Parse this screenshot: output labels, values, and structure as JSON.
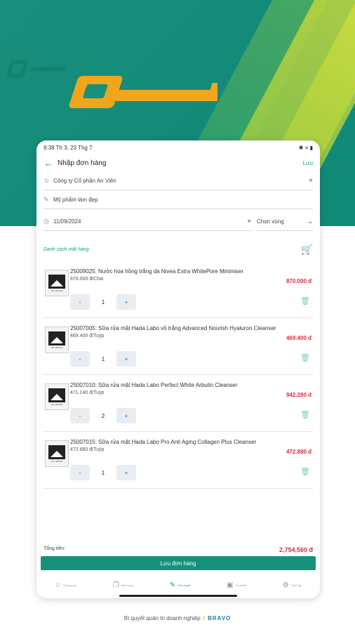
{
  "status_bar": {
    "time": "9:38 Th 3, 23 Thg 7",
    "icons": "✱ ≡ ▮"
  },
  "header": {
    "title": "Nhập đơn hàng",
    "save": "Lưu",
    "back_icon": "←"
  },
  "form": {
    "company": "Công ty Cổ phần An Viên",
    "category": "Mỹ phẩm làm đẹp",
    "date": "11/09/2024",
    "warehouse": "Chọn vùng"
  },
  "list_title": "Danh sách mặt hàng",
  "no_image": "NO IMAGE",
  "items": [
    {
      "name": "25009025: Nước hoa hồng trắng da Nivea Extra WhitePore Minimiser",
      "unit": "870.000 đ/Chai",
      "price": "870.000 đ",
      "qty": "1"
    },
    {
      "name": "25007005: Sữa rửa mặt Hada Labo vỏ trắng Advanced Nourish Hyaluron Cleanser",
      "unit": "469.400 đ/Tuýp",
      "price": "469.400 đ",
      "qty": "1"
    },
    {
      "name": "25007010: Sữa rửa mặt Hada Labo Perfect White Arbutin Cleanser",
      "unit": "471.140 đ/Tuýp",
      "price": "942.280 đ",
      "qty": "2"
    },
    {
      "name": "25007015: Sữa rửa mặt Hada Labo Pro Anti Aging Collagen Plus Cleanser",
      "unit": "472.880 đ/Tuýp",
      "price": "472.880 đ",
      "qty": "1"
    }
  ],
  "minus_label": "-",
  "plus_label": "+",
  "total": {
    "label": "Tổng tiền:",
    "amount": "2,754,560 đ"
  },
  "save_order": "Lưu đơn hàng",
  "nav": [
    {
      "label": "Tổng quan",
      "icon": "☆"
    },
    {
      "label": "Bán hàng",
      "icon": "❐"
    },
    {
      "label": "Phê duyệt",
      "icon": "✎"
    },
    {
      "label": "Tin nhắn",
      "icon": "▣"
    },
    {
      "label": "Thiết lập",
      "icon": "⚙"
    }
  ],
  "footer": {
    "text": "Bí quyết quản trị doanh nghiệp",
    "brand": "BRAVO"
  }
}
